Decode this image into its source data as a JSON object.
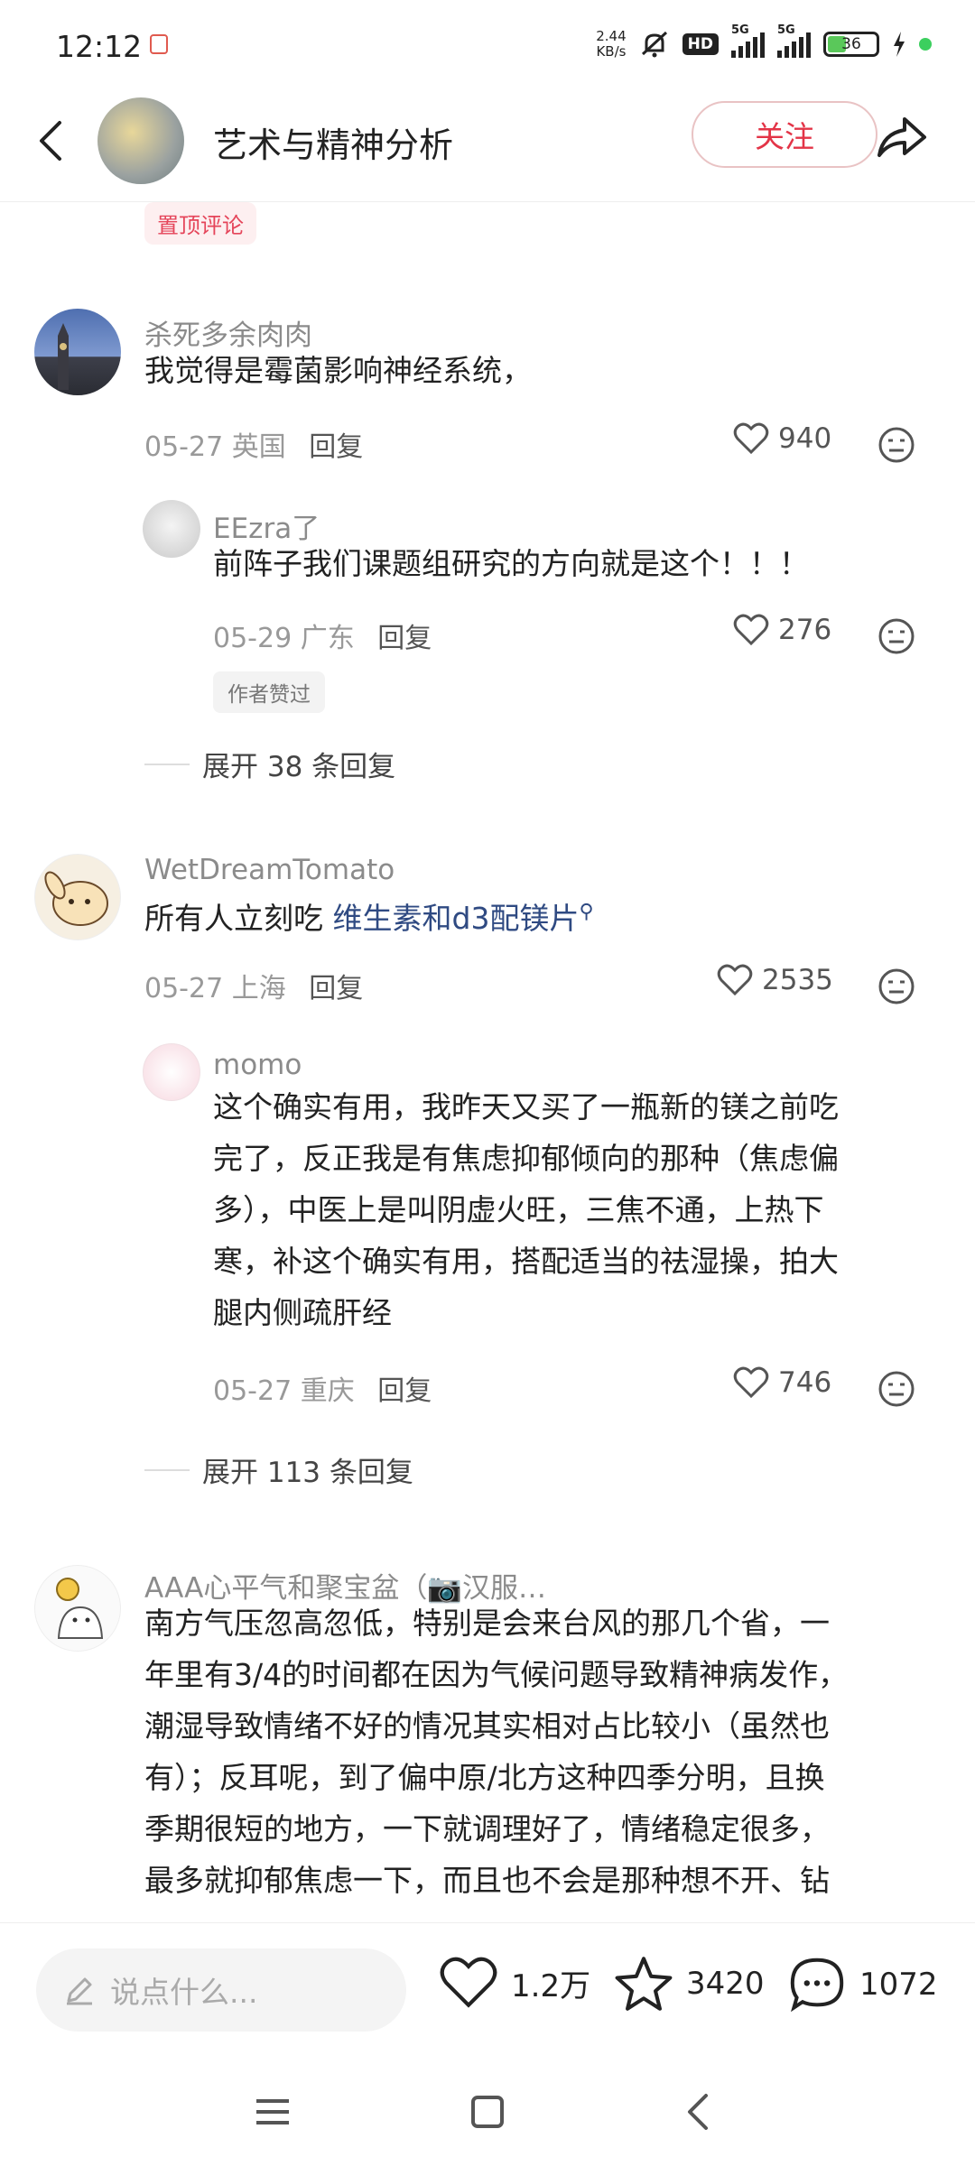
{
  "status_bar": {
    "time": "12:12",
    "net_speed_value": "2.44",
    "net_speed_unit": "KB/s",
    "hd_label": "HD",
    "signal_1": "5G",
    "signal_2": "5G",
    "battery": "36"
  },
  "header": {
    "title": "艺术与精神分析",
    "follow_label": "关注"
  },
  "pin_label": "置顶评论",
  "comments": [
    {
      "user": "杀死多余肉肉",
      "text": "我觉得是霉菌影响神经系统，",
      "date": "05-27",
      "location": "英国",
      "reply_label": "回复",
      "likes": "940",
      "replies": [
        {
          "user": "EEzra了",
          "text": "前阵子我们课题组研究的方向就是这个！！！",
          "date": "05-29",
          "location": "广东",
          "reply_label": "回复",
          "likes": "276",
          "badge": "作者赞过"
        }
      ],
      "expand": "展开 38 条回复"
    },
    {
      "user": "WetDreamTomato",
      "text_prefix": "所有人立刻吃 ",
      "text_link": "维生素和d3配镁片",
      "date": "05-27",
      "location": "上海",
      "reply_label": "回复",
      "likes": "2535",
      "replies": [
        {
          "user": "momo",
          "lines": [
            "这个确实有用，我昨天又买了一瓶新的镁之前吃",
            "完了，反正我是有焦虑抑郁倾向的那种（焦虑偏",
            "多），中医上是叫阴虚火旺，三焦不通，上热下",
            "寒，补这个确实有用，搭配适当的祛湿操，拍大",
            "腿内侧疏肝经"
          ],
          "date": "05-27",
          "location": "重庆",
          "reply_label": "回复",
          "likes": "746"
        }
      ],
      "expand": "展开 113 条回复"
    },
    {
      "user": "AAA心平气和聚宝盆（📷汉服…",
      "lines": [
        "南方气压忽高忽低，特别是会来台风的那几个省，一",
        "年里有3/4的时间都在因为气候问题导致精神病发作，",
        "潮湿导致情绪不好的情况其实相对占比较小（虽然也",
        "有）；反耳呢，到了偏中原/北方这种四季分明，且换",
        "季期很短的地方，一下就调理好了，情绪稳定很多，",
        "最多就抑郁焦虑一下，而且也不会是那种想不开、钻"
      ]
    }
  ],
  "bottom_bar": {
    "input_placeholder": "说点什么...",
    "likes": "1.2万",
    "favorites": "3420",
    "comments": "1072"
  }
}
